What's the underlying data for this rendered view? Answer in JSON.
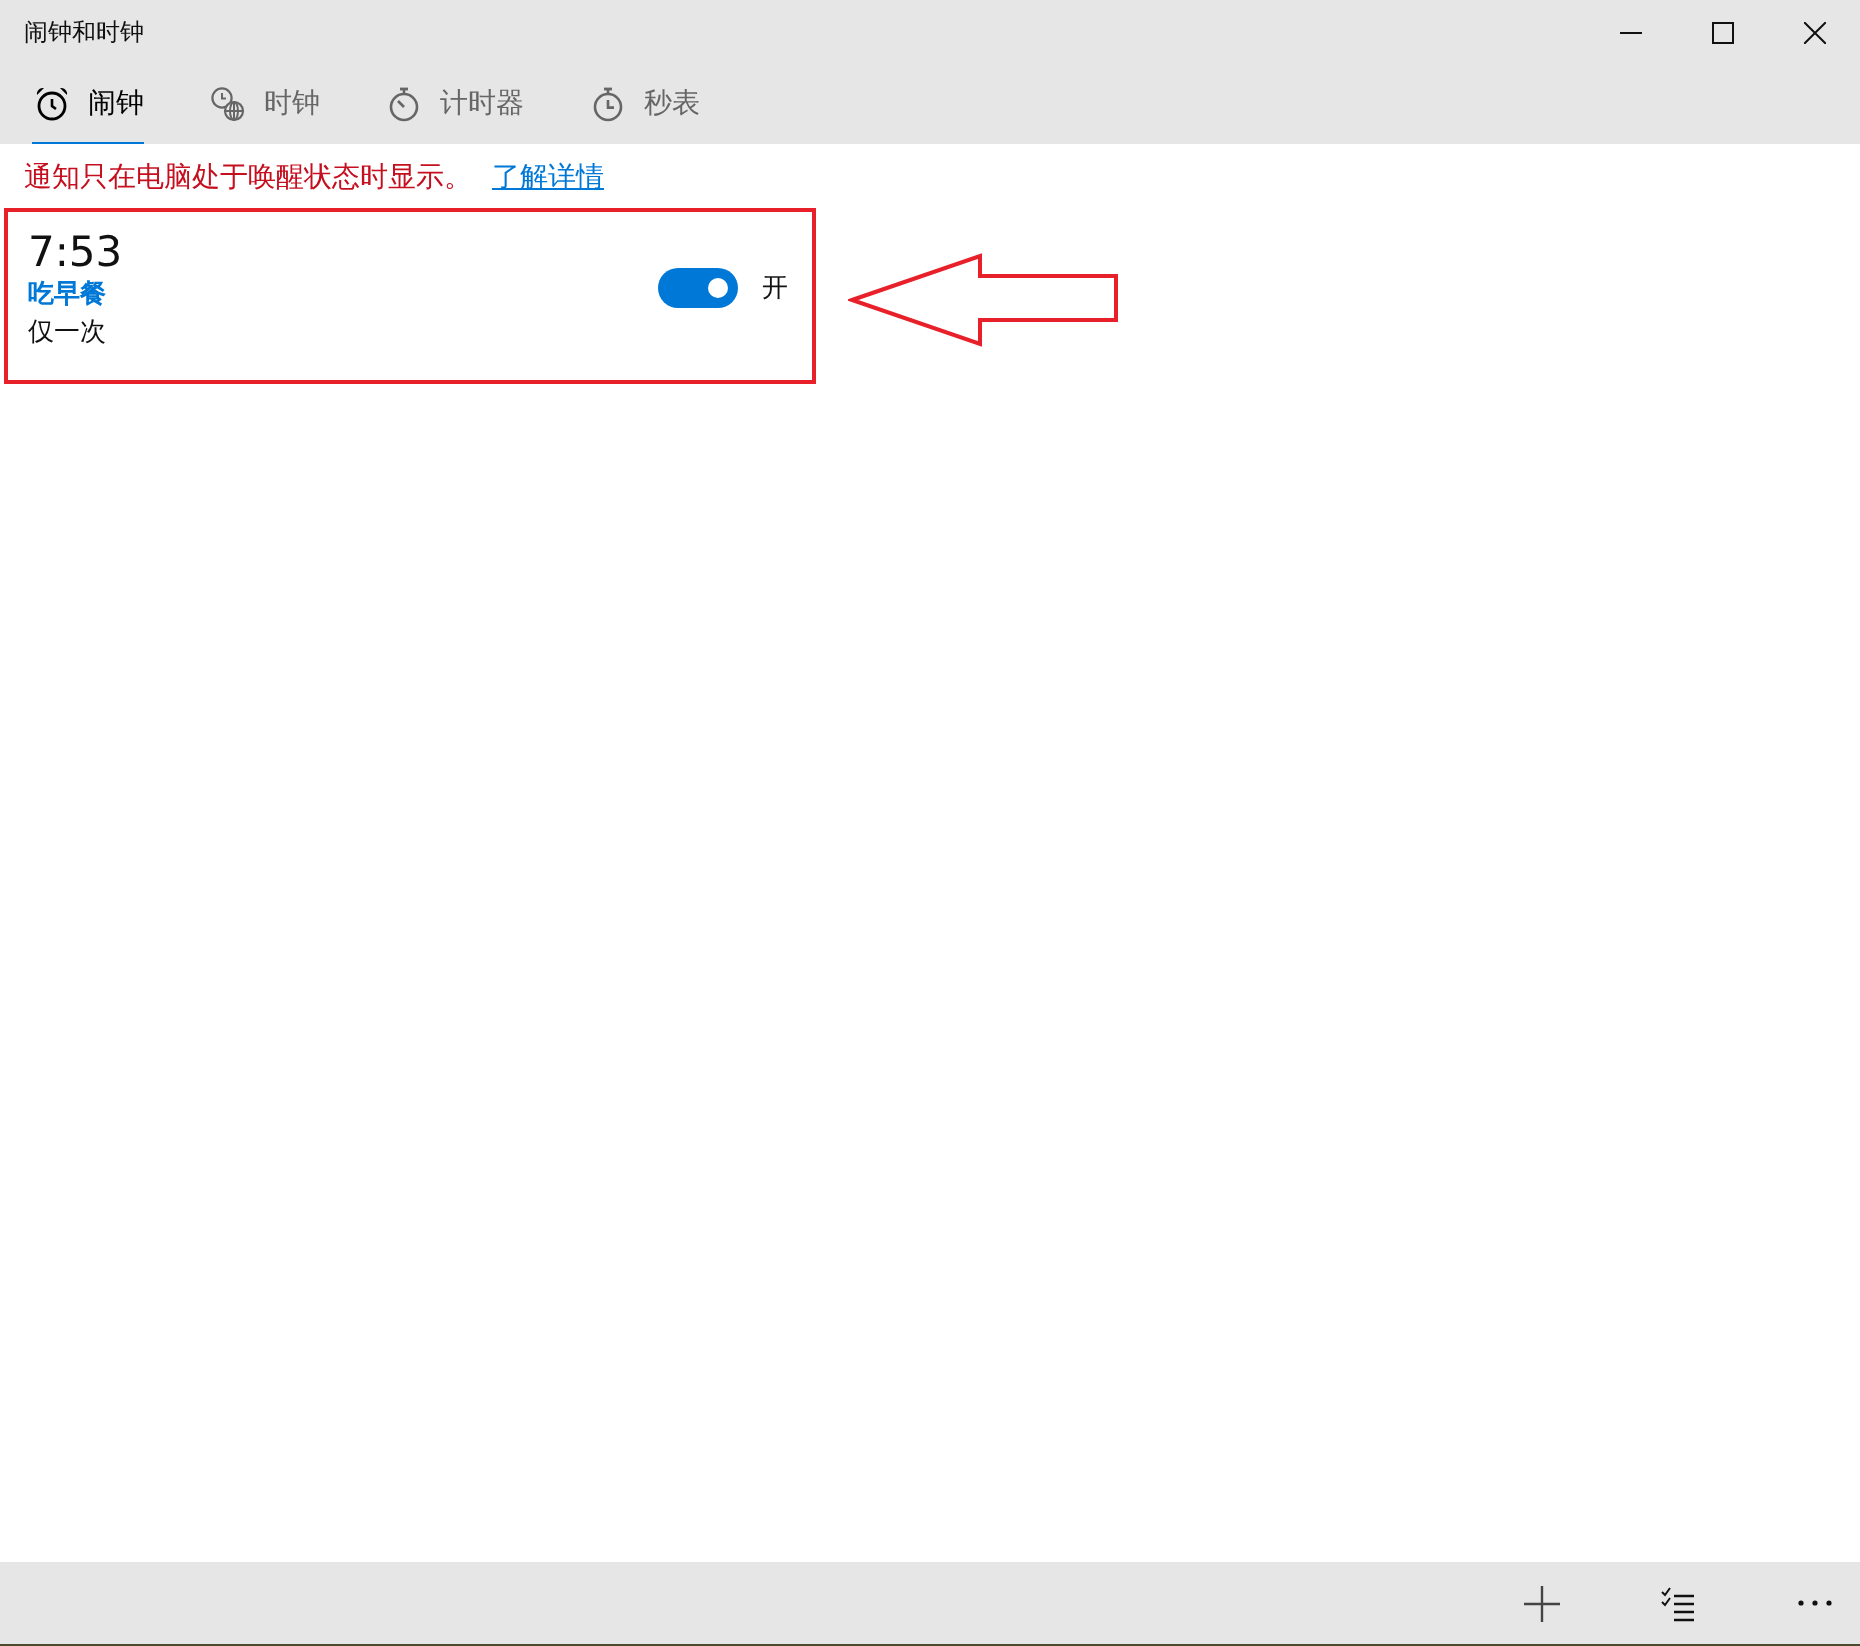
{
  "window": {
    "title": "闹钟和时钟"
  },
  "tabs": [
    {
      "label": "闹钟",
      "kind": "alarm",
      "selected": true
    },
    {
      "label": "时钟",
      "kind": "world",
      "selected": false
    },
    {
      "label": "计时器",
      "kind": "timer",
      "selected": false
    },
    {
      "label": "秒表",
      "kind": "stopwatch",
      "selected": false
    }
  ],
  "notice": {
    "text": "通知只在电脑处于唤醒状态时显示。",
    "link": "了解详情"
  },
  "alarms": [
    {
      "time": "7:53",
      "name": "吃早餐",
      "repeat": "仅一次",
      "on": true,
      "state_label": "开"
    }
  ]
}
